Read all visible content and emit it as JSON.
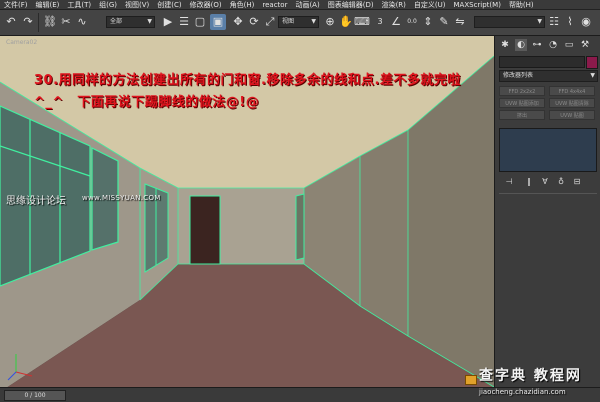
{
  "menu": {
    "items": [
      "文件(F)",
      "编辑(E)",
      "工具(T)",
      "组(G)",
      "视图(V)",
      "创建(C)",
      "修改器(O)",
      "角色(H)",
      "reactor",
      "动画(A)",
      "图表编辑器(D)",
      "渲染(R)",
      "自定义(U)",
      "MAXScript(M)",
      "帮助(H)"
    ]
  },
  "toolbar": {
    "selection_filter": "全部",
    "ref_coord": "视图",
    "snap_value": "0.0"
  },
  "viewport": {
    "label": "Camera02",
    "instruction": "30.用同样的方法创建出所有的门和窗.移除多余的线和点.差不多就完啦^_^　下面再说下踢脚线的做法@!@"
  },
  "watermarks": {
    "forum": "思缘设计论坛",
    "site": "www.MISSYUAN.COM",
    "brand": "查字典 教程网",
    "brand_url": "jiaocheng.chazidian.com"
  },
  "command_panel": {
    "modifier_list": "修改器列表",
    "mod_buttons": [
      "FFD 2x2x2",
      "FFD 4x4x4",
      "UVW 贴图添加",
      "UVW 贴图清除",
      "挤出",
      "UVW 贴图"
    ]
  },
  "timeline": {
    "frame_label": "0 / 100"
  },
  "colors": {
    "instruction_text": "#e0141e",
    "edge_highlight": "#40f0a0",
    "stack_panel": "#2e3d4e"
  }
}
